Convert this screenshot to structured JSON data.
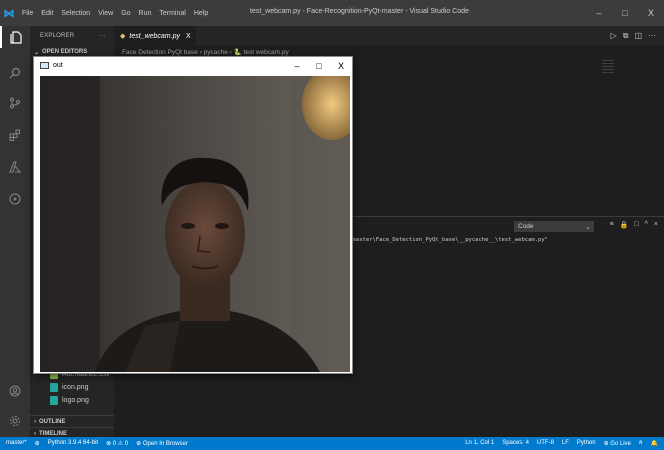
{
  "titlebar": {
    "menu": [
      "File",
      "Edit",
      "Selection",
      "View",
      "Go",
      "Run",
      "Terminal",
      "Help"
    ],
    "title": "test_webcam.py - Face-Recognition-PyQt-master - Visual Studio Code",
    "controls": [
      "–",
      "□",
      "X"
    ]
  },
  "sidebar": {
    "header": "EXPLORER",
    "header_more": "···",
    "open_editors": "OPEN EDITORS",
    "files": [
      {
        "name": "Attendance.csv",
        "color": "#8bc34a"
      },
      {
        "name": "icon.png",
        "color": "#26a69a"
      },
      {
        "name": "logo.png",
        "color": "#26a69a"
      }
    ],
    "outline": "OUTLINE",
    "timeline": "TIMELINE"
  },
  "editor": {
    "tab_label": "test_webcam.py",
    "tab_close": "X",
    "breadcrumb": "Face Detection PyQt base › pycache › 🐍 test webcam.py",
    "actions": [
      "▷",
      "⧉",
      "◫",
      "···"
    ]
  },
  "panel": {
    "select_value": "Code",
    "output_line": "t-master\\Face_Detection_PyQt_base\\__pycache__\\test_webcam.py\"",
    "icons": [
      "≡",
      "🔒",
      "□",
      "^",
      "×"
    ]
  },
  "camera_window": {
    "title": "out",
    "controls": [
      "–",
      "□",
      "X"
    ]
  },
  "statusbar": {
    "left": [
      "master*",
      "⊕",
      "Python 3.9.4 64-bit",
      "⊗ 0 ⚠ 0",
      "⊕ Open In Browser"
    ],
    "right": [
      "Ln 1, Col 1",
      "Spaces: 4",
      "UTF-8",
      "LF",
      "Python",
      "⊕ Go Live",
      "ጸ",
      "🔔"
    ]
  },
  "colors": {
    "accent": "#007acc",
    "activity_bar": "#333333",
    "sidebar": "#252526",
    "editor_bg": "#1e1e1e"
  }
}
